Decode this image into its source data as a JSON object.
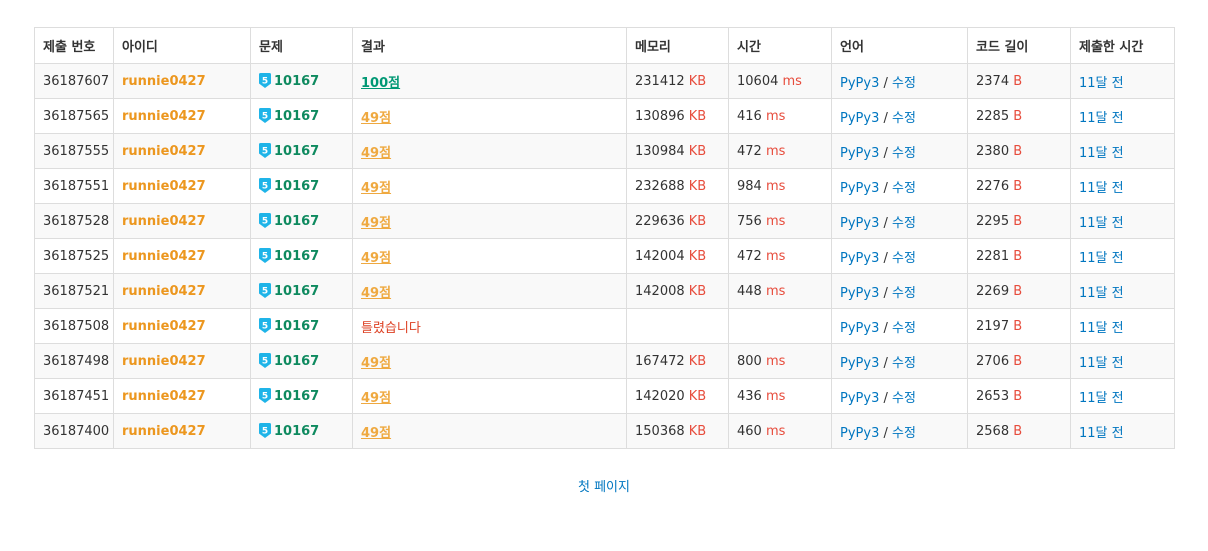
{
  "headers": [
    "제출 번호",
    "아이디",
    "문제",
    "결과",
    "메모리",
    "시간",
    "언어",
    "코드 길이",
    "제출한 시간"
  ],
  "units": {
    "memory": "KB",
    "time": "ms",
    "code": "B"
  },
  "lang_separator": "/",
  "tier_level": "5",
  "colors": {
    "user": "#ec971f",
    "accepted": "#009874",
    "partial": "#efa940",
    "wrong": "#dd4124",
    "unit": "#e74c3c",
    "link": "#0076c0",
    "tier": "#1fb4e8"
  },
  "rows": [
    {
      "id": "36187607",
      "user": "runnie0427",
      "problem": "10167",
      "result": "100점",
      "result_type": "ac",
      "memory": "231412",
      "time": "10604",
      "lang": "PyPy3",
      "edit": "수정",
      "code": "2374",
      "submitted": "11달 전"
    },
    {
      "id": "36187565",
      "user": "runnie0427",
      "problem": "10167",
      "result": "49점",
      "result_type": "pa",
      "memory": "130896",
      "time": "416",
      "lang": "PyPy3",
      "edit": "수정",
      "code": "2285",
      "submitted": "11달 전"
    },
    {
      "id": "36187555",
      "user": "runnie0427",
      "problem": "10167",
      "result": "49점",
      "result_type": "pa",
      "memory": "130984",
      "time": "472",
      "lang": "PyPy3",
      "edit": "수정",
      "code": "2380",
      "submitted": "11달 전"
    },
    {
      "id": "36187551",
      "user": "runnie0427",
      "problem": "10167",
      "result": "49점",
      "result_type": "pa",
      "memory": "232688",
      "time": "984",
      "lang": "PyPy3",
      "edit": "수정",
      "code": "2276",
      "submitted": "11달 전"
    },
    {
      "id": "36187528",
      "user": "runnie0427",
      "problem": "10167",
      "result": "49점",
      "result_type": "pa",
      "memory": "229636",
      "time": "756",
      "lang": "PyPy3",
      "edit": "수정",
      "code": "2295",
      "submitted": "11달 전"
    },
    {
      "id": "36187525",
      "user": "runnie0427",
      "problem": "10167",
      "result": "49점",
      "result_type": "pa",
      "memory": "142004",
      "time": "472",
      "lang": "PyPy3",
      "edit": "수정",
      "code": "2281",
      "submitted": "11달 전"
    },
    {
      "id": "36187521",
      "user": "runnie0427",
      "problem": "10167",
      "result": "49점",
      "result_type": "pa",
      "memory": "142008",
      "time": "448",
      "lang": "PyPy3",
      "edit": "수정",
      "code": "2269",
      "submitted": "11달 전"
    },
    {
      "id": "36187508",
      "user": "runnie0427",
      "problem": "10167",
      "result": "틀렸습니다",
      "result_type": "wa",
      "memory": "",
      "time": "",
      "lang": "PyPy3",
      "edit": "수정",
      "code": "2197",
      "submitted": "11달 전"
    },
    {
      "id": "36187498",
      "user": "runnie0427",
      "problem": "10167",
      "result": "49점",
      "result_type": "pa",
      "memory": "167472",
      "time": "800",
      "lang": "PyPy3",
      "edit": "수정",
      "code": "2706",
      "submitted": "11달 전"
    },
    {
      "id": "36187451",
      "user": "runnie0427",
      "problem": "10167",
      "result": "49점",
      "result_type": "pa",
      "memory": "142020",
      "time": "436",
      "lang": "PyPy3",
      "edit": "수정",
      "code": "2653",
      "submitted": "11달 전"
    },
    {
      "id": "36187400",
      "user": "runnie0427",
      "problem": "10167",
      "result": "49점",
      "result_type": "pa",
      "memory": "150368",
      "time": "460",
      "lang": "PyPy3",
      "edit": "수정",
      "code": "2568",
      "submitted": "11달 전"
    }
  ],
  "pagination": {
    "first_page": "첫 페이지"
  }
}
